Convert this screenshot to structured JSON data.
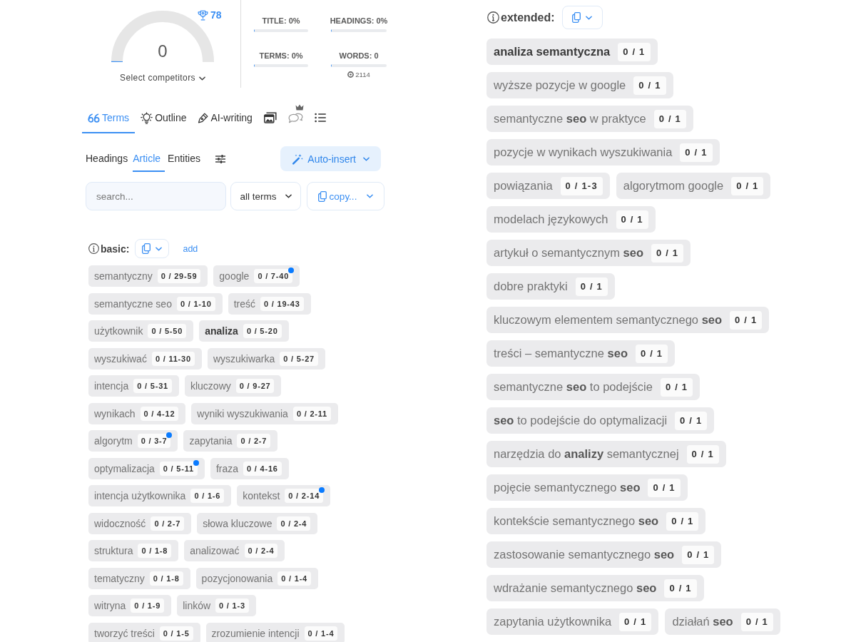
{
  "score": {
    "value": "0",
    "level": 0,
    "benchmark": "78",
    "competitors_label": "Select competitors"
  },
  "stats": [
    {
      "label": "TITLE: 0%",
      "level": 0
    },
    {
      "label": "HEADINGS: 0%",
      "level": 0
    },
    {
      "label": "TERMS: 0%",
      "level": 0
    },
    {
      "label": "WORDS: 0",
      "level": 0,
      "note": "2114"
    }
  ],
  "tabs": [
    {
      "kind": "text",
      "label": "Terms",
      "selected": true,
      "premium": false
    },
    {
      "kind": "text",
      "label": "Outline",
      "selected": false,
      "premium": false
    },
    {
      "kind": "text",
      "label": "AI-writing",
      "selected": false,
      "premium": false
    },
    {
      "kind": "icon",
      "selected": false,
      "premium": false
    },
    {
      "kind": "icon",
      "selected": false,
      "premium": true
    },
    {
      "kind": "icon",
      "selected": false,
      "premium": false
    }
  ],
  "subtabs": [
    {
      "label": "Headings",
      "selected": false
    },
    {
      "label": "Article",
      "selected": true
    },
    {
      "label": "Entities",
      "selected": false
    }
  ],
  "auto_insert": {
    "label": "Auto-insert"
  },
  "search": {
    "placeholder": "search..."
  },
  "term_filter": {
    "value": "all terms"
  },
  "copy_menu": {
    "label": "copy..."
  },
  "basic": {
    "title": "basic:",
    "add_label": "add",
    "terms": [
      {
        "term": "semantyczny",
        "count": "0 / 29-59",
        "highlighted": false,
        "dot": false
      },
      {
        "term": "google",
        "count": "0 / 7-40",
        "highlighted": false,
        "dot": true
      },
      {
        "term": "semantyczne seo",
        "count": "0 / 1-10",
        "highlighted": false,
        "dot": false
      },
      {
        "term": "treść",
        "count": "0 / 19-43",
        "highlighted": false,
        "dot": false
      },
      {
        "term": "użytkownik",
        "count": "0 / 5-50",
        "highlighted": false,
        "dot": false
      },
      {
        "term": "analiza",
        "count": "0 / 5-20",
        "highlighted": true,
        "dot": false
      },
      {
        "term": "wyszukiwać",
        "count": "0 / 11-30",
        "highlighted": false,
        "dot": false
      },
      {
        "term": "wyszukiwarka",
        "count": "0 / 5-27",
        "highlighted": false,
        "dot": false
      },
      {
        "term": "intencja",
        "count": "0 / 5-31",
        "highlighted": false,
        "dot": false
      },
      {
        "term": "kluczowy",
        "count": "0 / 9-27",
        "highlighted": false,
        "dot": false
      },
      {
        "term": "wynikach",
        "count": "0 / 4-12",
        "highlighted": false,
        "dot": false
      },
      {
        "term": "wyniki wyszukiwania",
        "count": "0 / 2-11",
        "highlighted": false,
        "dot": false
      },
      {
        "term": "algorytm",
        "count": "0 / 3-7",
        "highlighted": false,
        "dot": true
      },
      {
        "term": "zapytania",
        "count": "0 / 2-7",
        "highlighted": false,
        "dot": false
      },
      {
        "term": "optymalizacja",
        "count": "0 / 5-11",
        "highlighted": false,
        "dot": true
      },
      {
        "term": "fraza",
        "count": "0 / 4-16",
        "highlighted": false,
        "dot": false
      },
      {
        "term": "intencja użytkownika",
        "count": "0 / 1-6",
        "highlighted": false,
        "dot": false
      },
      {
        "term": "kontekst",
        "count": "0 / 2-14",
        "highlighted": false,
        "dot": true
      },
      {
        "term": "widoczność",
        "count": "0 / 2-7",
        "highlighted": false,
        "dot": false
      },
      {
        "term": "słowa kluczowe",
        "count": "0 / 2-4",
        "highlighted": false,
        "dot": false
      },
      {
        "term": "struktura",
        "count": "0 / 1-8",
        "highlighted": false,
        "dot": false
      },
      {
        "term": "analizować",
        "count": "0 / 2-4",
        "highlighted": false,
        "dot": false
      },
      {
        "term": "tematyczny",
        "count": "0 / 1-8",
        "highlighted": false,
        "dot": false
      },
      {
        "term": "pozycjonowania",
        "count": "0 / 1-4",
        "highlighted": false,
        "dot": false
      },
      {
        "term": "witryna",
        "count": "0 / 1-9",
        "highlighted": false,
        "dot": false
      },
      {
        "term": "linków",
        "count": "0 / 1-3",
        "highlighted": false,
        "dot": false
      },
      {
        "term": "tworzyć treści",
        "count": "0 / 1-5",
        "highlighted": false,
        "dot": false
      },
      {
        "term": "zrozumienie intencji",
        "count": "0 / 1-4",
        "highlighted": false,
        "dot": false
      }
    ]
  },
  "extended": {
    "title": "extended:",
    "terms": [
      {
        "term": "analiza semantyczna",
        "count": "0 / 1",
        "highlighted": true
      },
      {
        "term": "wyższe pozycje w google",
        "count": "0 / 1",
        "highlighted": false
      },
      {
        "term": "semantyczne **seo** w praktyce",
        "count": "0 / 1",
        "highlighted": false
      },
      {
        "term": "pozycje w wynikach wyszukiwania",
        "count": "0 / 1",
        "highlighted": false
      },
      {
        "term": "powiązania",
        "count": "0 / 1-3",
        "highlighted": false
      },
      {
        "term": "algorytmom google",
        "count": "0 / 1",
        "highlighted": false
      },
      {
        "term": "modelach językowych",
        "count": "0 / 1",
        "highlighted": false
      },
      {
        "term": "artykuł o semantycznym **seo**",
        "count": "0 / 1",
        "highlighted": false
      },
      {
        "term": "dobre praktyki",
        "count": "0 / 1",
        "highlighted": false
      },
      {
        "term": "kluczowym elementem semantycznego **seo**",
        "count": "0 / 1",
        "highlighted": false
      },
      {
        "term": "treści – semantyczne **seo**",
        "count": "0 / 1",
        "highlighted": false
      },
      {
        "term": "semantyczne **seo** to podejście",
        "count": "0 / 1",
        "highlighted": false
      },
      {
        "term": "**seo** to podejście do optymalizacji",
        "count": "0 / 1",
        "highlighted": false
      },
      {
        "term": "narzędzia do **analizy** semantycznej",
        "count": "0 / 1",
        "highlighted": false
      },
      {
        "term": "pojęcie semantycznego **seo**",
        "count": "0 / 1",
        "highlighted": false
      },
      {
        "term": "kontekście semantycznego **seo**",
        "count": "0 / 1",
        "highlighted": false
      },
      {
        "term": "zastosowanie semantycznego **seo**",
        "count": "0 / 1",
        "highlighted": false
      },
      {
        "term": "wdrażanie semantycznego **seo**",
        "count": "0 / 1",
        "highlighted": false
      },
      {
        "term": "zapytania użytkownika",
        "count": "0 / 1",
        "highlighted": false
      },
      {
        "term": "działań **seo**",
        "count": "0 / 1",
        "highlighted": false
      }
    ]
  }
}
